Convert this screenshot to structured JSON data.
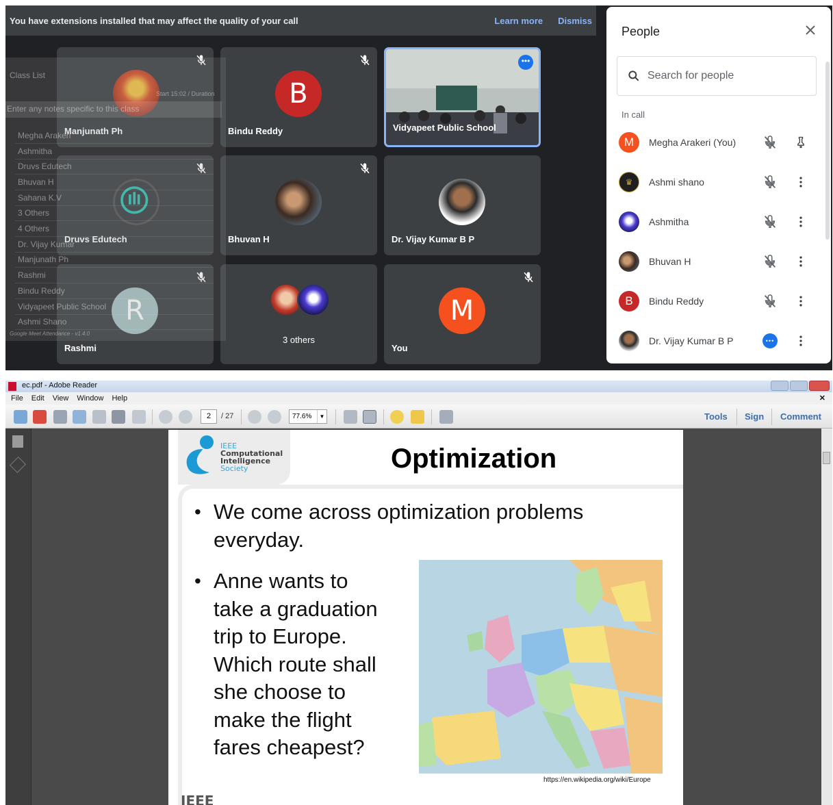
{
  "meet": {
    "banner": {
      "message": "You have extensions installed that may affect the quality of your call",
      "learn_more": "Learn more",
      "dismiss": "Dismiss"
    },
    "tiles": {
      "manjunath": "Manjunath Ph",
      "bindu": "Bindu Reddy",
      "bindu_initial": "B",
      "vidyapeet": "Vidyapeet Public School",
      "druvs": "Druvs Edutech",
      "bhuvan": "Bhuvan H",
      "vijay": "Dr. Vijay Kumar B P",
      "rashmi": "Rashmi",
      "rashmi_initial": "R",
      "others": "3 others",
      "you": "You",
      "you_initial": "M"
    },
    "attendance": {
      "title": "Class List",
      "notes_placeholder": "Enter any notes specific to this class",
      "stats": "Start 15:02 / Duration",
      "rows": [
        "Megha Arakeri",
        "Ashmitha",
        "Druvs Edutech",
        "Bhuvan H",
        "Sahana K.V",
        "3 Others",
        "4 Others",
        "Dr. Vijay Kumar",
        "Manjunath Ph",
        "Rashmi",
        "Bindu Reddy",
        "Vidyapeet Public School",
        "Ashmi Shano"
      ],
      "footer": "Google Meet Attendance - v1.4.0"
    },
    "people": {
      "title": "People",
      "search_placeholder": "Search for people",
      "section": "In call",
      "list": [
        {
          "name": "Megha Arakeri (You)",
          "initial": "M",
          "color": "#f4511e"
        },
        {
          "name": "Ashmi shano",
          "initial": "",
          "color": "#1f1f1f"
        },
        {
          "name": "Ashmitha",
          "initial": "",
          "color": "#1a237e"
        },
        {
          "name": "Bhuvan H",
          "initial": "",
          "color": "#5d4a3c"
        },
        {
          "name": "Bindu Reddy",
          "initial": "B",
          "color": "#c62828"
        },
        {
          "name": "Dr. Vijay Kumar B P",
          "initial": "",
          "color": "#6d4c41"
        }
      ]
    }
  },
  "reader": {
    "window_title": "ec.pdf - Adobe Reader",
    "menu": [
      "File",
      "Edit",
      "View",
      "Window",
      "Help"
    ],
    "page_current": "2",
    "page_total": "/ 27",
    "zoom": "77.6%",
    "right_links": [
      "Tools",
      "Sign",
      "Comment"
    ],
    "slide": {
      "logo_line1": "IEEE",
      "logo_line2": "Computational",
      "logo_line3": "Intelligence",
      "logo_line4": "Society",
      "title": "Optimization",
      "bullet1_line1": "We come across optimization problems",
      "bullet1_line2": "everyday.",
      "bullet2_lines": [
        "Anne wants to",
        "take a graduation",
        "trip to Europe.",
        "Which route shall",
        "she choose to",
        "make the flight",
        "fares cheapest?"
      ],
      "map_credit": "https://en.wikipedia.org/wiki/Europe",
      "footer_logo": "IEEE"
    }
  }
}
